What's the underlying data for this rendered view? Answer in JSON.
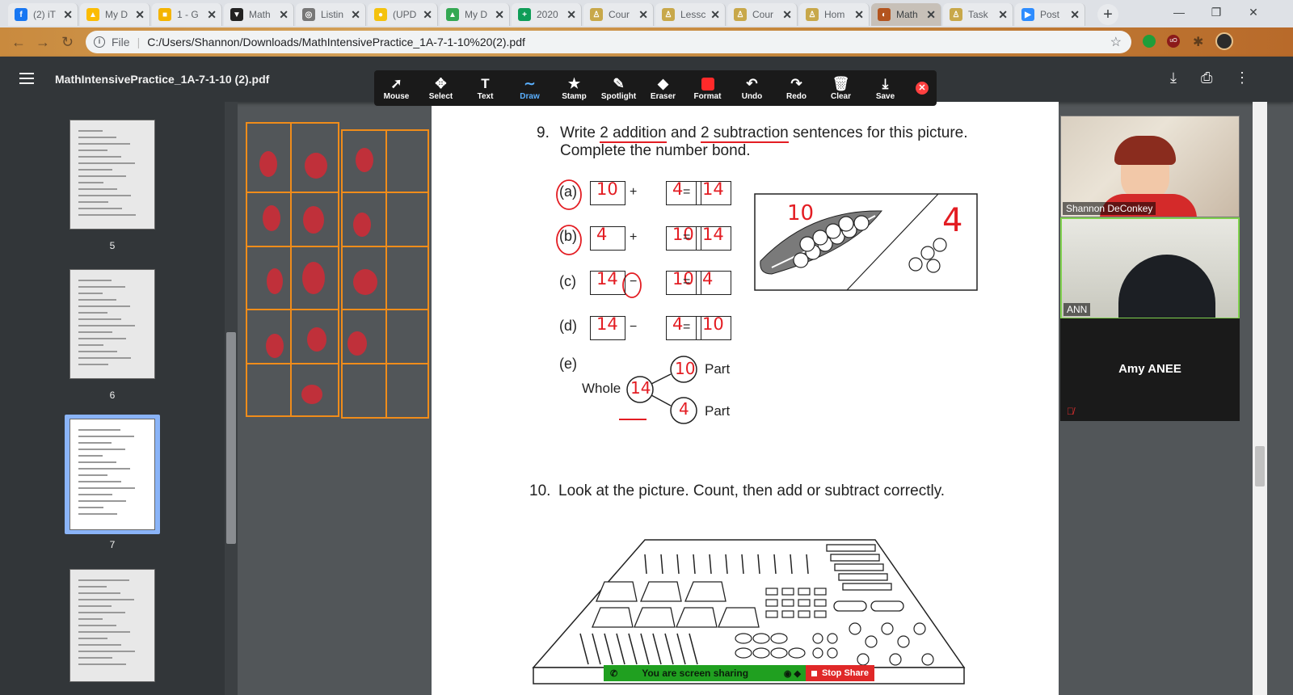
{
  "browser": {
    "tabs": [
      {
        "label": "(2) iT",
        "favicon": "facebook-icon",
        "color": "#1877f2",
        "glyph": "f"
      },
      {
        "label": "My D",
        "favicon": "drive-icon",
        "color": "#fbbc04",
        "glyph": "▲"
      },
      {
        "label": "1 - G",
        "favicon": "slides-icon",
        "color": "#f4b400",
        "glyph": "■"
      },
      {
        "label": "Math",
        "favicon": "shield-icon",
        "color": "#222222",
        "glyph": "▼"
      },
      {
        "label": "Listin",
        "favicon": "globe-icon",
        "color": "#777777",
        "glyph": "◎"
      },
      {
        "label": "(UPD",
        "favicon": "circle-icon",
        "color": "#f4c20d",
        "glyph": "●"
      },
      {
        "label": "My D",
        "favicon": "drive-icon",
        "color": "#34a853",
        "glyph": "▲"
      },
      {
        "label": "2020",
        "favicon": "sheets-icon",
        "color": "#0f9d58",
        "glyph": "+"
      },
      {
        "label": "Cour",
        "favicon": "school-icon",
        "color": "#c8a84a",
        "glyph": "♙"
      },
      {
        "label": "Lessc",
        "favicon": "school-icon",
        "color": "#c8a84a",
        "glyph": "♙"
      },
      {
        "label": "Cour",
        "favicon": "school-icon",
        "color": "#c8a84a",
        "glyph": "♙"
      },
      {
        "label": "Hom",
        "favicon": "school-icon",
        "color": "#c8a84a",
        "glyph": "♙"
      },
      {
        "label": "Math",
        "favicon": "pdf-icon",
        "color": "#b3541e",
        "glyph": "◐"
      },
      {
        "label": "Task",
        "favicon": "school-icon",
        "color": "#c8a84a",
        "glyph": "♙"
      },
      {
        "label": "Post",
        "favicon": "zoom-icon",
        "color": "#2d8cff",
        "glyph": "▶"
      }
    ],
    "url_label": "File",
    "url": "C:/Users/Shannon/Downloads/MathIntensivePractice_1A-7-1-10%20(2).pdf"
  },
  "pdf": {
    "title": "MathIntensivePractice_1A-7-1-10 (2).pdf",
    "thumb_pages": [
      "5",
      "6",
      "7"
    ],
    "current_page": "7"
  },
  "annotate": {
    "tools": [
      {
        "label": "Mouse",
        "icon": "cursor-icon",
        "glyph": "➚"
      },
      {
        "label": "Select",
        "icon": "move-icon",
        "glyph": "✥"
      },
      {
        "label": "Text",
        "icon": "text-icon",
        "glyph": "T"
      },
      {
        "label": "Draw",
        "icon": "draw-icon",
        "glyph": "∼"
      },
      {
        "label": "Stamp",
        "icon": "star-icon",
        "glyph": "★"
      },
      {
        "label": "Spotlight",
        "icon": "wand-icon",
        "glyph": "✎"
      },
      {
        "label": "Eraser",
        "icon": "eraser-icon",
        "glyph": "◆"
      },
      {
        "label": "Format",
        "icon": "format-icon",
        "glyph": "■"
      },
      {
        "label": "Undo",
        "icon": "undo-icon",
        "glyph": "↶"
      },
      {
        "label": "Redo",
        "icon": "redo-icon",
        "glyph": "↷"
      },
      {
        "label": "Clear",
        "icon": "trash-icon",
        "glyph": "🗑"
      },
      {
        "label": "Save",
        "icon": "save-icon",
        "glyph": "⤓"
      }
    ],
    "active": "Draw",
    "format_color": "#ff2a2a"
  },
  "worksheet": {
    "q9": {
      "number": "9.",
      "line1_a": "Write",
      "line1_b": "2 addition",
      "line1_c": "and",
      "line1_d": "2 subtraction",
      "line1_e": "sentences for this picture.",
      "line2": "Complete the number bond.",
      "items": [
        "(a)",
        "(b)",
        "(c)",
        "(d)",
        "(e)"
      ],
      "ops": [
        "+",
        "+",
        "−",
        "−"
      ],
      "equals": "=",
      "answers": [
        [
          "10",
          "4",
          "14"
        ],
        [
          "4",
          "10",
          "14"
        ],
        [
          "14",
          "10",
          "4"
        ],
        [
          "14",
          "4",
          "10"
        ]
      ],
      "bond": {
        "whole_label": "Whole",
        "part_label": "Part",
        "whole": "14",
        "part1": "10",
        "part2": "4"
      },
      "pic_left": "10",
      "pic_right": "4"
    },
    "q10": {
      "number": "10.",
      "text": "Look at the picture. Count, then add or subtract correctly."
    }
  },
  "zoom": {
    "participants": [
      "Shannon DeConkey",
      "ANN"
    ],
    "audio_only": "Amy ANEE",
    "sharing_text": "You are screen sharing",
    "stop_label": "Stop Share"
  }
}
